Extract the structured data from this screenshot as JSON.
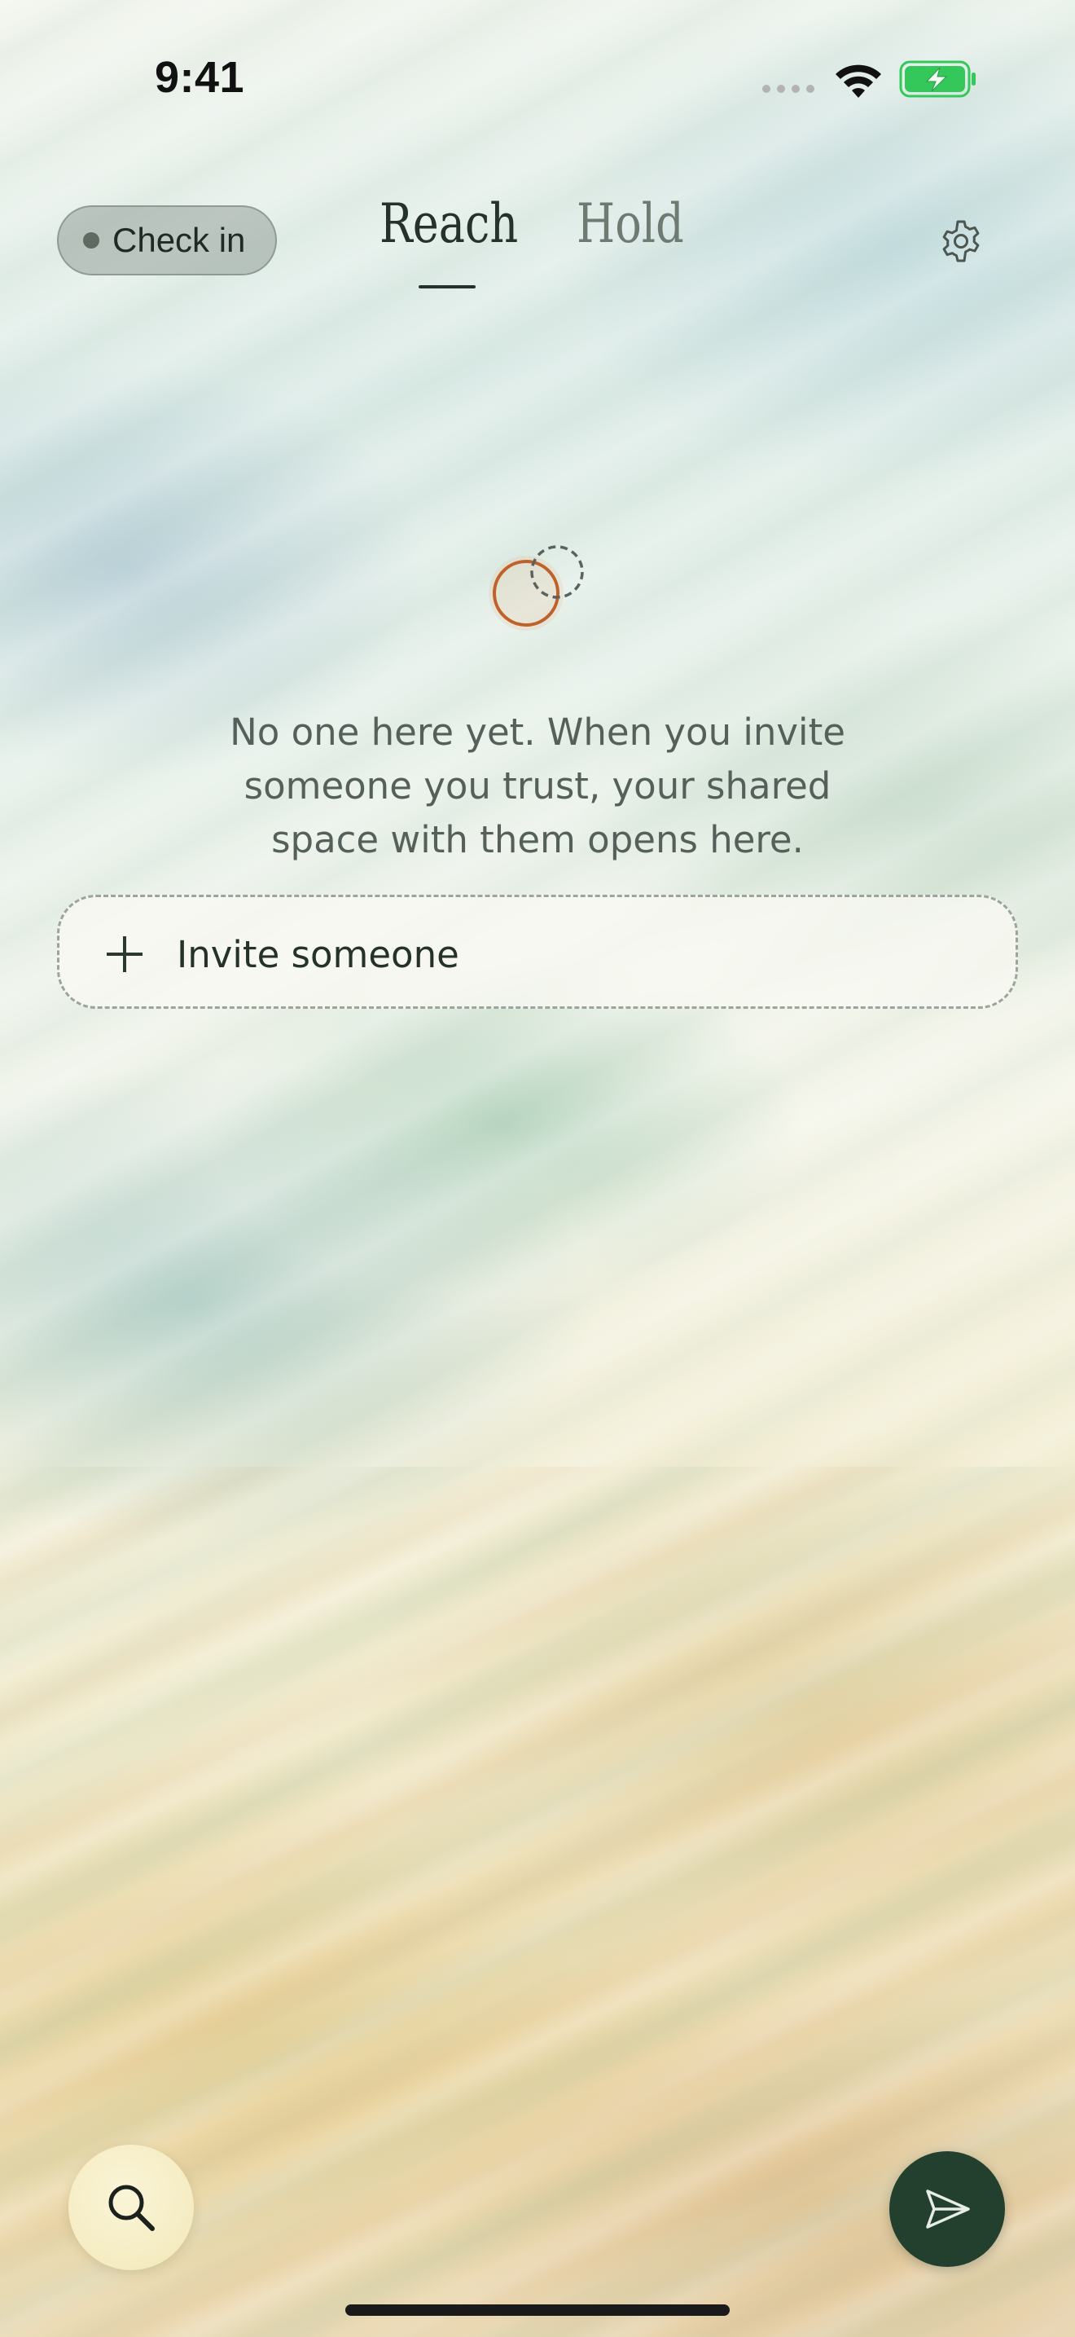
{
  "status_bar": {
    "time": "9:41",
    "icons": [
      "signal-dots-icon",
      "wifi-icon",
      "battery-charging-icon"
    ],
    "battery_color": "#34c759"
  },
  "header": {
    "checkin_label": "Check in",
    "tabs": [
      {
        "label": "Reach",
        "active": true
      },
      {
        "label": "Hold",
        "active": false
      }
    ],
    "settings_icon": "gear-icon"
  },
  "empty_state": {
    "icon": "overlapping-circles-icon",
    "message": "No one here yet. When you invite someone you trust, your shared space with them opens here."
  },
  "invite": {
    "icon": "plus-icon",
    "label": "Invite someone"
  },
  "bottom": {
    "search_icon": "search-icon",
    "send_icon": "send-icon"
  },
  "colors": {
    "accent_dark": "#23402f",
    "accent_orange": "#c0602a",
    "search_bg": "#f4ecc4"
  }
}
